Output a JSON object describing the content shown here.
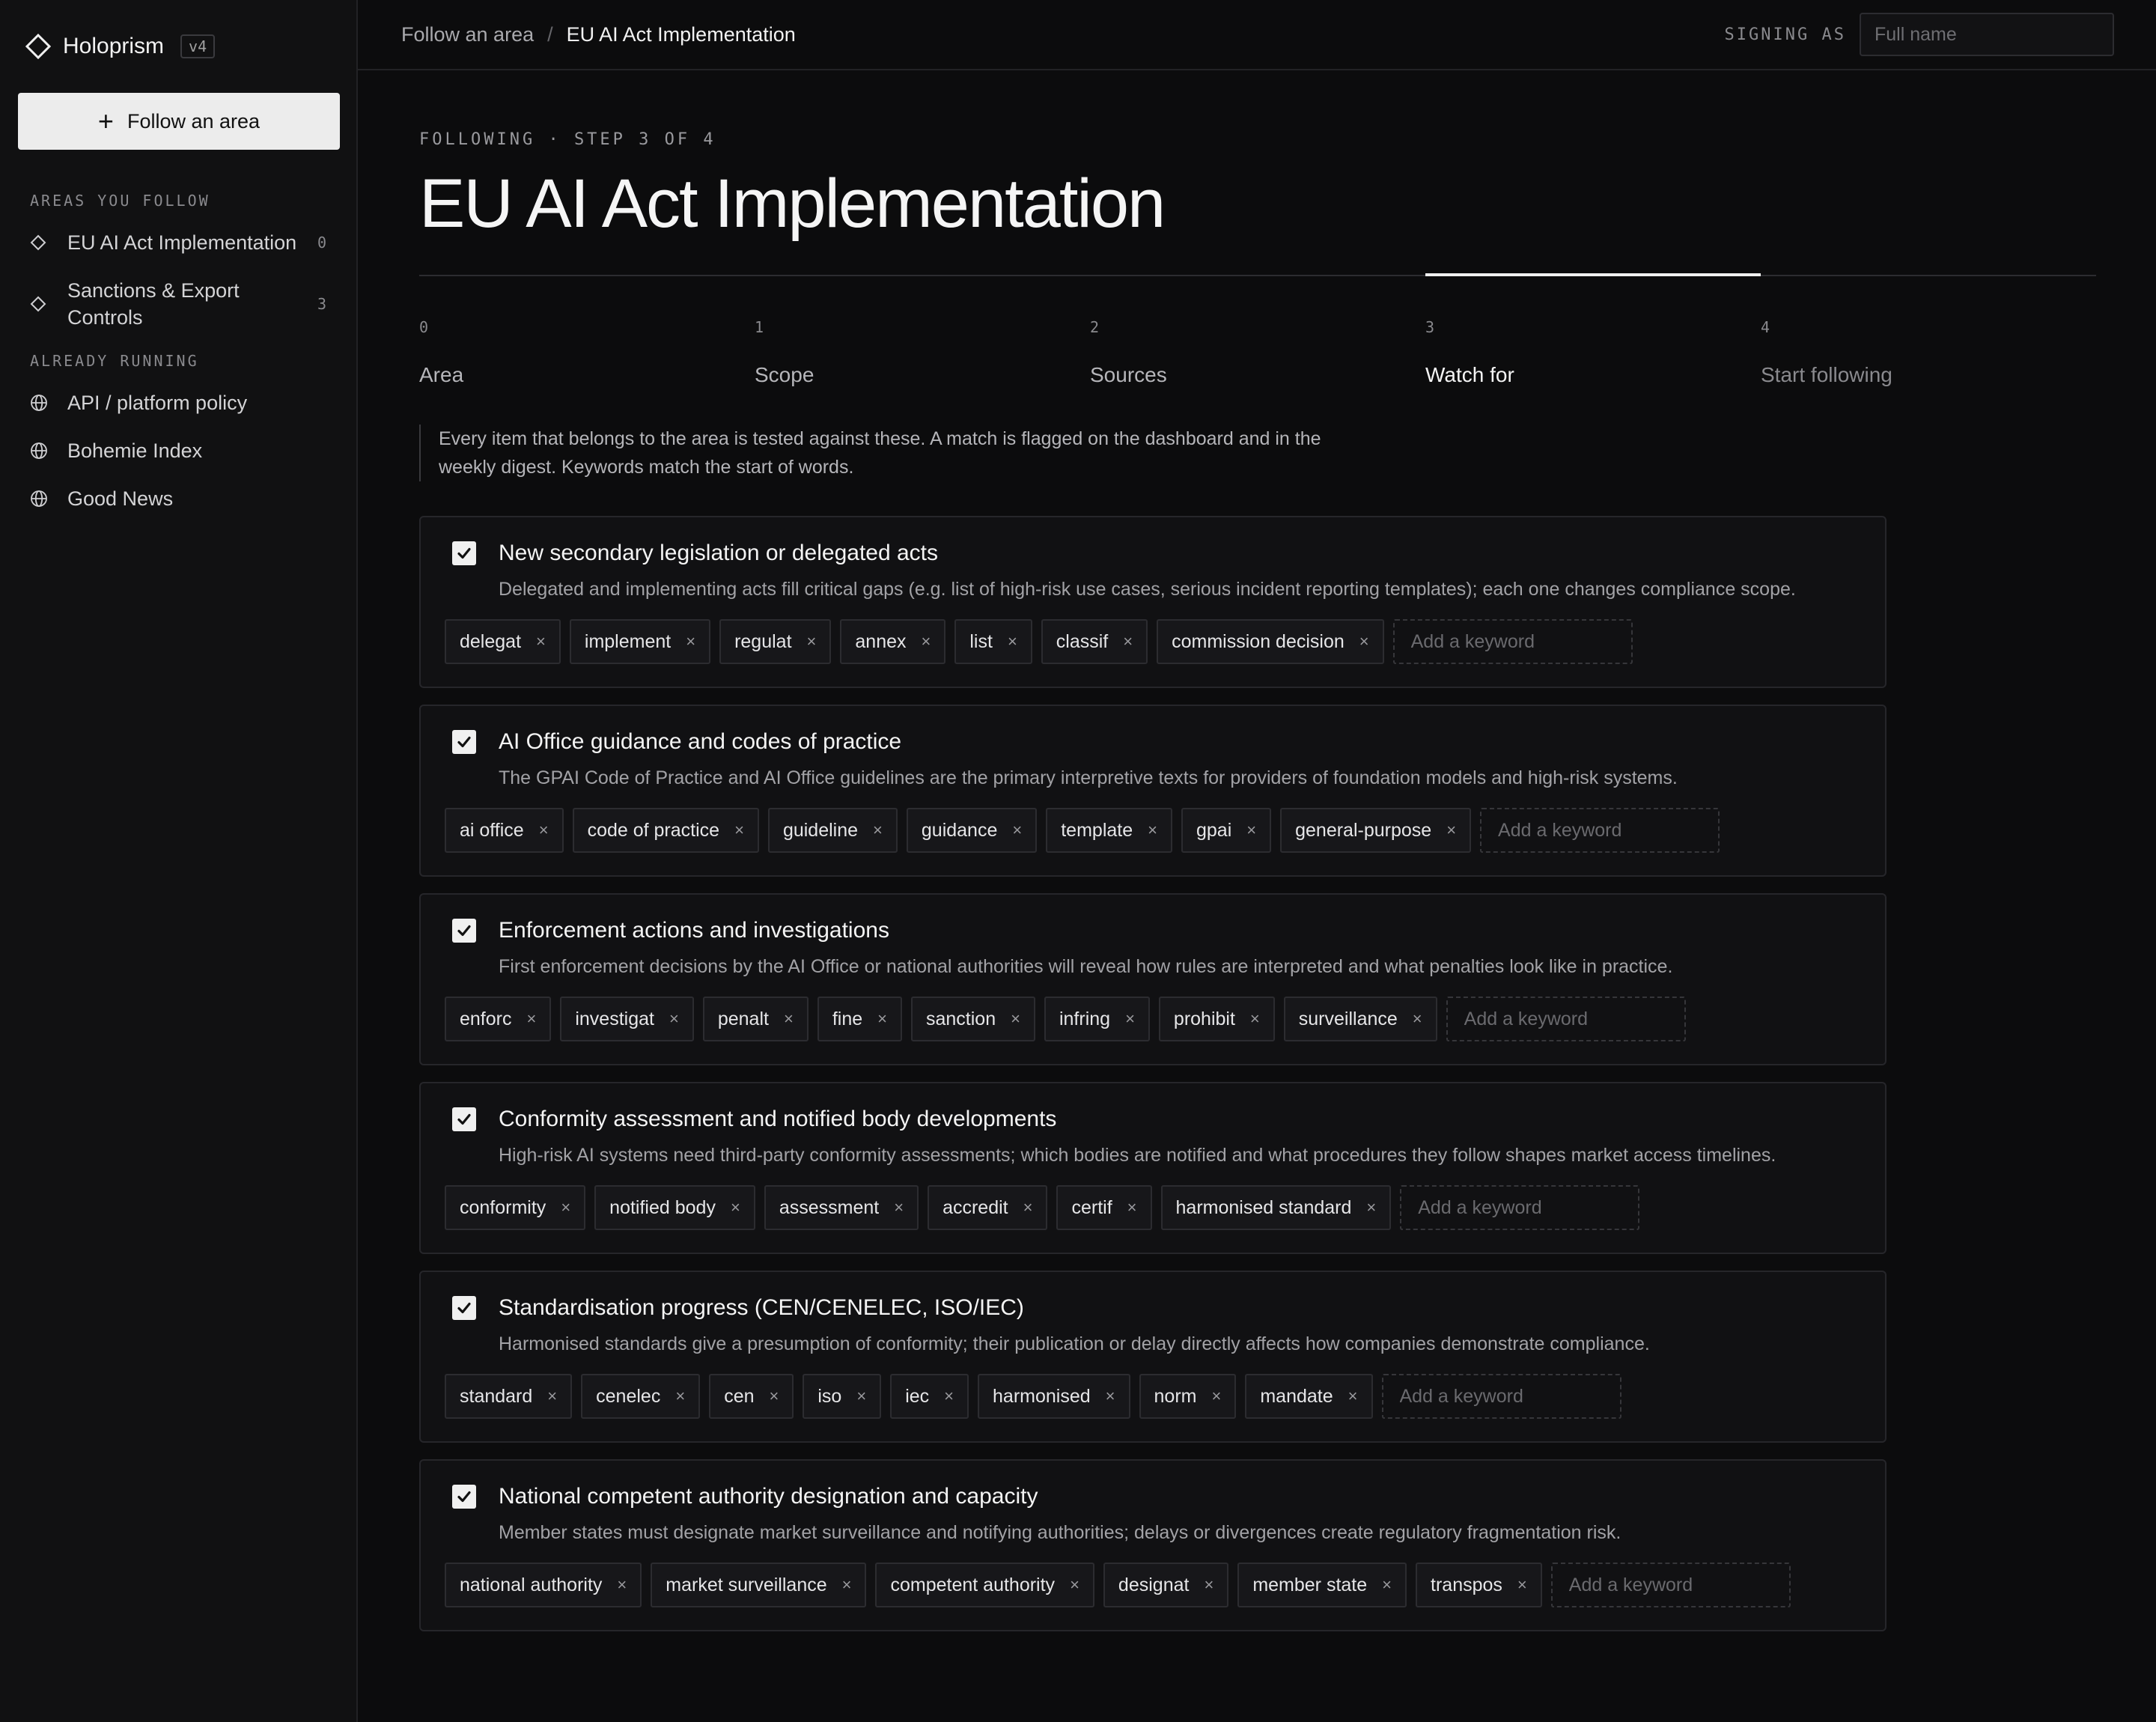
{
  "app": {
    "name": "Holoprism",
    "version": "v4"
  },
  "sidebar": {
    "follow_button": "Follow an area",
    "follow_section": "AREAS YOU FOLLOW",
    "followed": [
      {
        "label": "EU AI Act Implementation",
        "count": "0"
      },
      {
        "label": "Sanctions & Export Controls",
        "count": "3"
      }
    ],
    "running_section": "ALREADY RUNNING",
    "running": [
      {
        "label": "API / platform policy"
      },
      {
        "label": "Bohemie Index"
      },
      {
        "label": "Good News"
      }
    ]
  },
  "topbar": {
    "breadcrumb_parent": "Follow an area",
    "breadcrumb_sep": "/",
    "breadcrumb_current": "EU AI Act Implementation",
    "signing_label": "SIGNING AS",
    "name_placeholder": "Full name"
  },
  "page": {
    "eyebrow": "FOLLOWING · STEP 3 OF 4",
    "title": "EU AI Act Implementation",
    "intro": "Every item that belongs to the area is tested against these. A match is flagged on the dashboard and in the weekly digest. Keywords match the start of words."
  },
  "steps": [
    {
      "num": "0",
      "label": "Area",
      "state": "done"
    },
    {
      "num": "1",
      "label": "Scope",
      "state": "done"
    },
    {
      "num": "2",
      "label": "Sources",
      "state": "done"
    },
    {
      "num": "3",
      "label": "Watch for",
      "state": "active"
    },
    {
      "num": "4",
      "label": "Start following",
      "state": "future"
    }
  ],
  "keyword_placeholder": "Add a keyword",
  "remove_glyph": "×",
  "cards": [
    {
      "checked": true,
      "title": "New secondary legislation or delegated acts",
      "desc": "Delegated and implementing acts fill critical gaps (e.g. list of high-risk use cases, serious incident reporting templates); each one changes compliance scope.",
      "keywords": [
        "delegat",
        "implement",
        "regulat",
        "annex",
        "list",
        "classif",
        "commission decision"
      ]
    },
    {
      "checked": true,
      "title": "AI Office guidance and codes of practice",
      "desc": "The GPAI Code of Practice and AI Office guidelines are the primary interpretive texts for providers of foundation models and high-risk systems.",
      "keywords": [
        "ai office",
        "code of practice",
        "guideline",
        "guidance",
        "template",
        "gpai",
        "general-purpose"
      ]
    },
    {
      "checked": true,
      "title": "Enforcement actions and investigations",
      "desc": "First enforcement decisions by the AI Office or national authorities will reveal how rules are interpreted and what penalties look like in practice.",
      "keywords": [
        "enforc",
        "investigat",
        "penalt",
        "fine",
        "sanction",
        "infring",
        "prohibit",
        "surveillance"
      ]
    },
    {
      "checked": true,
      "title": "Conformity assessment and notified body developments",
      "desc": "High-risk AI systems need third-party conformity assessments; which bodies are notified and what procedures they follow shapes market access timelines.",
      "keywords": [
        "conformity",
        "notified body",
        "assessment",
        "accredit",
        "certif",
        "harmonised standard"
      ]
    },
    {
      "checked": true,
      "title": "Standardisation progress (CEN/CENELEC, ISO/IEC)",
      "desc": "Harmonised standards give a presumption of conformity; their publication or delay directly affects how companies demonstrate compliance.",
      "keywords": [
        "standard",
        "cenelec",
        "cen",
        "iso",
        "iec",
        "harmonised",
        "norm",
        "mandate"
      ]
    },
    {
      "checked": true,
      "title": "National competent authority designation and capacity",
      "desc": "Member states must designate market surveillance and notifying authorities; delays or divergences create regulatory fragmentation risk.",
      "keywords": [
        "national authority",
        "market surveillance",
        "competent authority",
        "designat",
        "member state",
        "transpos"
      ]
    }
  ]
}
